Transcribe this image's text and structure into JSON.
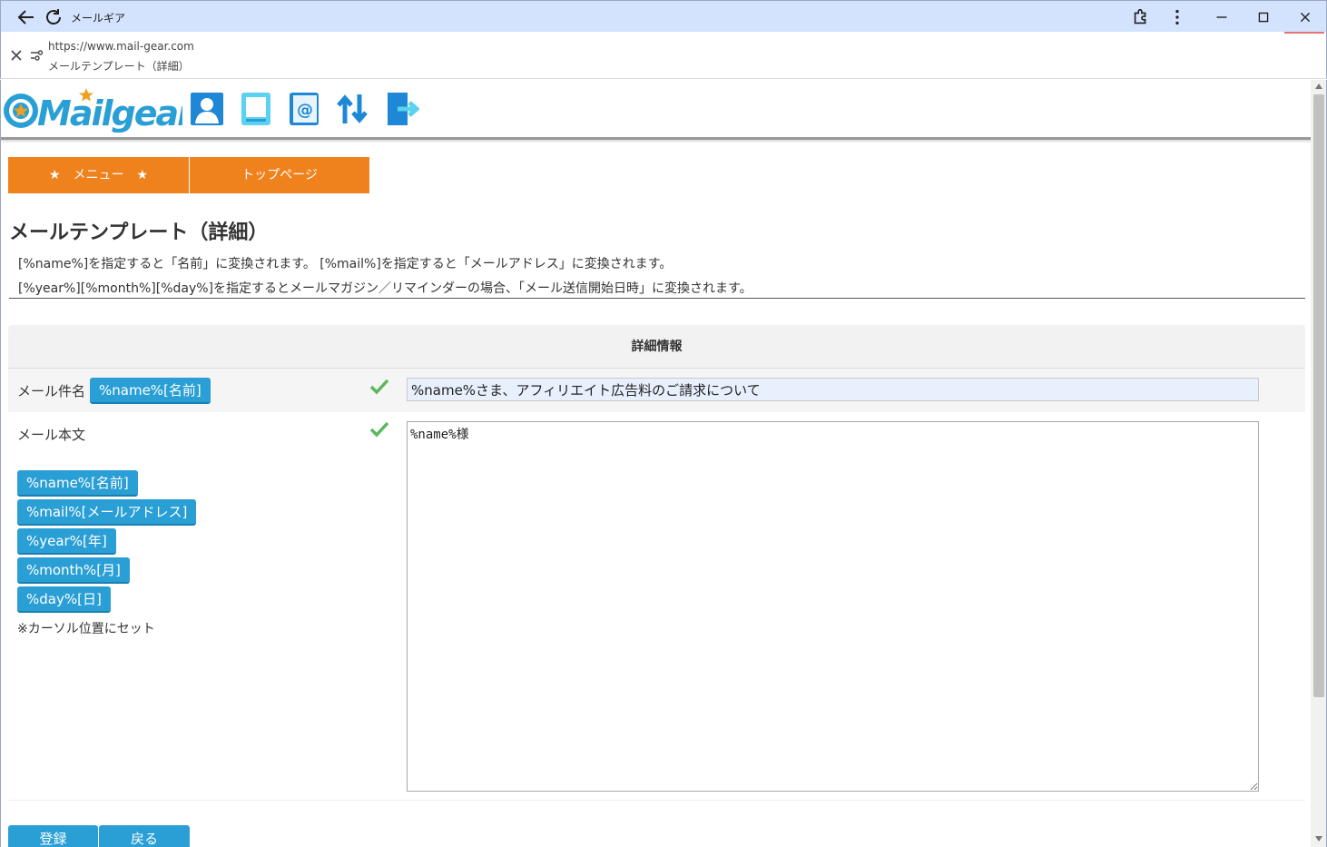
{
  "window": {
    "title": "メールギア"
  },
  "urlbar": {
    "url": "https://www.mail-gear.com",
    "page_title": "メールテンプレート（詳細）"
  },
  "header": {
    "logo_text": "Mailgear",
    "icons": [
      "user-icon",
      "book-icon",
      "address-book-icon",
      "sync-icon",
      "logout-icon"
    ]
  },
  "nav": {
    "menu_label": "★　メニュー　★",
    "top_label": "トップページ"
  },
  "main": {
    "title": "メールテンプレート（詳細）",
    "note1": "[%name%]を指定すると「名前」に変換されます。 [%mail%]を指定すると「メールアドレス」に変換されます。",
    "note2": "[%year%][%month%][%day%]を指定するとメールマガジン／リマインダーの場合、「メール送信開始日時」に変換されます。"
  },
  "detail": {
    "header": "詳細情報",
    "subject_label": "メール件名",
    "subject_tag": "%name%[名前]",
    "subject_value": "%name%さま、アフィリエイト広告料のご請求について",
    "body_label": "メール本文",
    "body_value": "%name%様",
    "tags": [
      "%name%[名前]",
      "%mail%[メールアドレス]",
      "%year%[年]",
      "%month%[月]",
      "%day%[日]"
    ],
    "cursor_note": "※カーソル位置にセット"
  },
  "actions": {
    "register_label": "登録",
    "back_label": "戻る"
  },
  "colors": {
    "accent": "#f0821e",
    "button_blue": "#2a9fd6",
    "check_green": "#5cb85c",
    "titlebar": "#d3e3fd"
  }
}
